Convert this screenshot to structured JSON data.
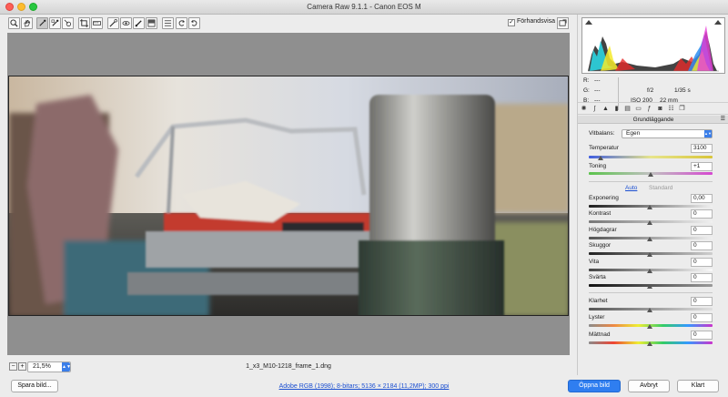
{
  "window": {
    "title": "Camera Raw 9.1.1  -  Canon EOS M"
  },
  "toolbar": {
    "tools": [
      {
        "name": "zoom-tool-icon",
        "glyph": "⌕"
      },
      {
        "name": "hand-tool-icon",
        "glyph": "✋"
      },
      {
        "name": "white-balance-tool-icon",
        "glyph": "✎"
      },
      {
        "name": "color-sampler-tool-icon",
        "glyph": "✎"
      },
      {
        "name": "targeted-adjustment-tool-icon",
        "glyph": "◎"
      },
      {
        "name": "crop-tool-icon",
        "glyph": "⌗"
      },
      {
        "name": "straighten-tool-icon",
        "glyph": "▭"
      },
      {
        "name": "spot-removal-tool-icon",
        "glyph": "✐"
      },
      {
        "name": "red-eye-tool-icon",
        "glyph": "◉"
      },
      {
        "name": "adjustment-brush-icon",
        "glyph": "✏"
      },
      {
        "name": "graduated-filter-icon",
        "glyph": "▥"
      },
      {
        "name": "radial-filter-icon",
        "glyph": "◍"
      },
      {
        "name": "preferences-icon",
        "glyph": "☰"
      },
      {
        "name": "rotate-ccw-icon",
        "glyph": "↺"
      },
      {
        "name": "rotate-cw-icon",
        "glyph": "↻"
      }
    ],
    "preview_label": "Förhandsvisa",
    "preview_checked": true
  },
  "canvas": {
    "zoom": "21,5%",
    "filename": "1_x3_M10-1218_frame_1.dng"
  },
  "footer": {
    "save_label": "Spara bild...",
    "workflow_link": "Adobe RGB (1998); 8-bitars; 5136 × 2184 (11,2MP); 300 ppi",
    "open_label": "Öppna bild",
    "cancel_label": "Avbryt",
    "done_label": "Klart"
  },
  "readout": {
    "r_label": "R:",
    "r_value": "---",
    "g_label": "G:",
    "g_value": "---",
    "b_label": "B:",
    "b_value": "---",
    "aperture": "f/2",
    "shutter": "1/35 s",
    "iso": "ISO 200",
    "focal": "22 mm"
  },
  "panel": {
    "section_title": "Grundläggande",
    "wb_label": "Vitbalans:",
    "wb_value": "Egen",
    "temperature_label": "Temperatur",
    "temperature_value": "3100",
    "tint_label": "Toning",
    "tint_value": "+1",
    "auto_label": "Auto",
    "default_label": "Standard",
    "exposure_label": "Exponering",
    "exposure_value": "0,00",
    "contrast_label": "Kontrast",
    "contrast_value": "0",
    "highlights_label": "Högdagrar",
    "highlights_value": "0",
    "shadows_label": "Skuggor",
    "shadows_value": "0",
    "whites_label": "Vita",
    "whites_value": "0",
    "blacks_label": "Svärta",
    "blacks_value": "0",
    "clarity_label": "Klarhet",
    "clarity_value": "0",
    "vibrance_label": "Lyster",
    "vibrance_value": "0",
    "saturation_label": "Mättnad",
    "saturation_value": "0"
  },
  "colors": {
    "accent": "#2f7ef0",
    "link": "#1b4fd1"
  }
}
